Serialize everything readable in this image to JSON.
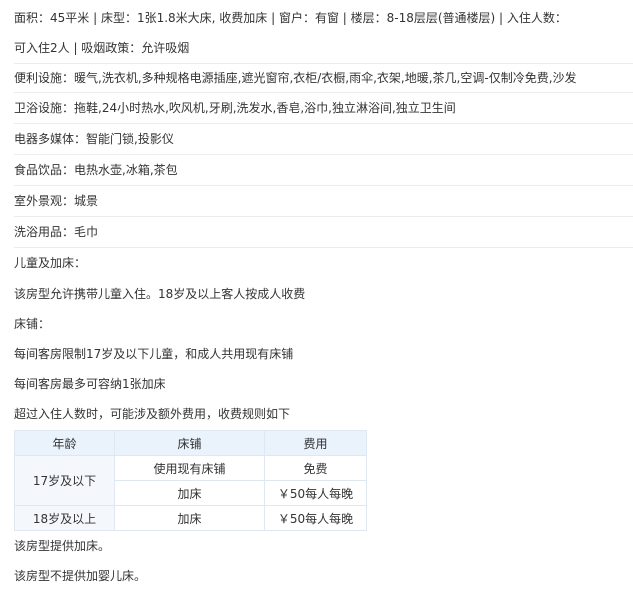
{
  "room": {
    "basic_line1": "面积：45平米 | 床型：1张1.8米大床, 收费加床 | 窗户：有窗 | 楼层：8-18层层(普通楼层) | 入住人数：",
    "basic_line2": "可入住2人 | 吸烟政策：允许吸烟",
    "facilities": "便利设施：暖气,洗衣机,多种规格电源插座,遮光窗帘,衣柜/衣橱,雨伞,衣架,地暖,茶几,空调-仅制冷免费,沙发",
    "bathroom": "卫浴设施：拖鞋,24小时热水,吹风机,牙刷,洗发水,香皂,浴巾,独立淋浴间,独立卫生间",
    "media": "电器多媒体：智能门锁,投影仪",
    "food": "食品饮品：电热水壶,冰箱,茶包",
    "view": "室外景观：城景",
    "toiletries": "洗浴用品：毛巾"
  },
  "policy": {
    "heading": "儿童及加床：",
    "children": "该房型允许携带儿童入住。18岁及以上客人按成人收费",
    "bedding_heading": "床铺：",
    "bedding_rule": "每间客房限制17岁及以下儿童，和成人共用现有床铺",
    "extra_bed_capacity": "每间客房最多可容纳1张加床",
    "fee_note": "超过入住人数时，可能涉及额外费用，收费规则如下"
  },
  "fee_table": {
    "headers": [
      "年龄",
      "床铺",
      "费用"
    ],
    "rows": [
      {
        "age": "17岁及以下",
        "bed": "使用现有床铺",
        "fee": "免费"
      },
      {
        "bed": "加床",
        "fee": "￥50每人每晚"
      },
      {
        "age": "18岁及以上",
        "bed": "加床",
        "fee": "￥50每人每晚"
      }
    ]
  },
  "footer": {
    "extra_bed": "该房型提供加床。",
    "crib": "该房型不提供加婴儿床。"
  },
  "colors": {
    "free_fee": "#2f87d8",
    "table_header": "#eaf2fc",
    "table_border": "#dfe7f2",
    "divider": "#ececec"
  }
}
